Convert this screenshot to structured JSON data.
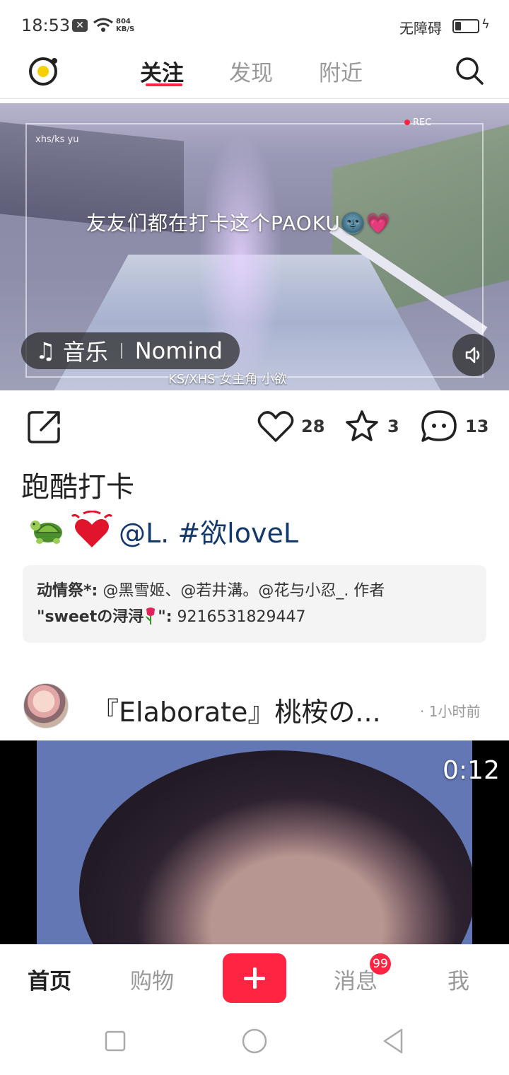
{
  "status_bar": {
    "time": "18:53",
    "notification_icon": "x-box-icon",
    "speed_value": "804",
    "speed_unit": "KB/S",
    "accessibility_label": "无障碍",
    "battery_icon": "battery-low-charging-icon"
  },
  "top_nav": {
    "tabs": [
      {
        "label": "关注",
        "active": true
      },
      {
        "label": "发现",
        "active": false
      },
      {
        "label": "附近",
        "active": false
      }
    ],
    "logo_icon": "camera-logo-icon",
    "search_icon": "search-icon"
  },
  "post1": {
    "media": {
      "caption": "友友们都在打卡这个PAOKU🌚💗",
      "watermark_top": "xhs/ks yu",
      "watermark_bottom": "KS/XHS 女主角 小欲",
      "rec_label": "REC",
      "music_label": "音乐",
      "music_name": "Nomind"
    },
    "actions": {
      "likes": "28",
      "favorites": "3",
      "comments": "13"
    },
    "title": "跑酷打卡",
    "mention": "@L. #欲loveL",
    "description": {
      "line1_bold": "动情祭*:",
      "line1_rest": "@黑雪姬、@若井溝。@花与小忍_. 作者",
      "line2_bold": "\"sweetの浔浔",
      "line2_tail_bold": "\":",
      "line2_rest": "9216531829447"
    }
  },
  "post2": {
    "title": "『Elaborate』桃桉の...",
    "time": "· 1小时前",
    "video_duration": "0:12"
  },
  "bottom_nav": {
    "items": [
      {
        "label": "首页",
        "active": true
      },
      {
        "label": "购物",
        "active": false
      },
      {
        "label": "消息",
        "active": false
      },
      {
        "label": "我",
        "active": false
      }
    ],
    "badge": "99"
  },
  "colors": {
    "accent": "#ff2442",
    "mention": "#13386c"
  }
}
